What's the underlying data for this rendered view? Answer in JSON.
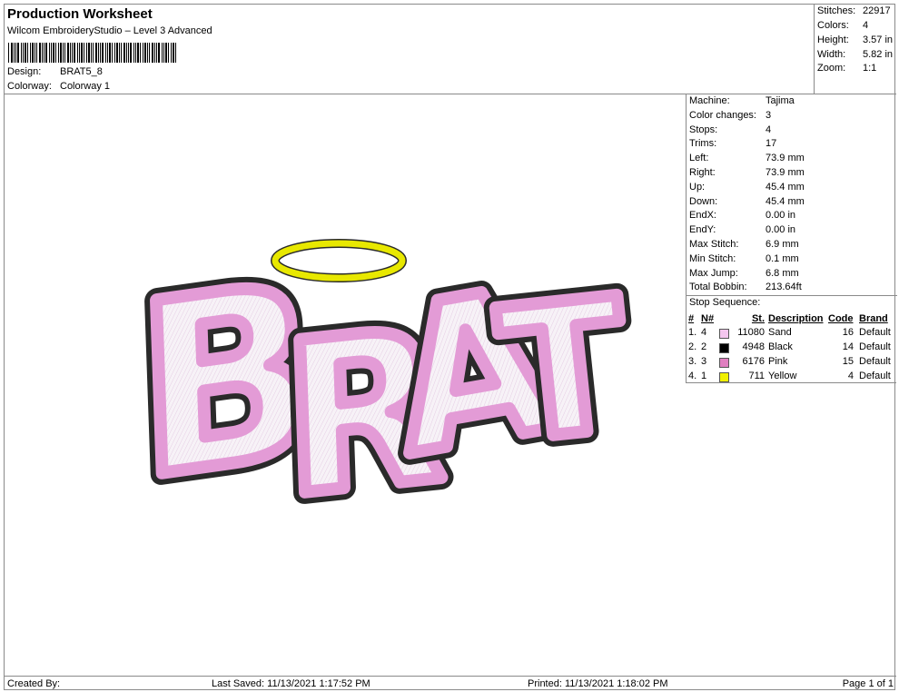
{
  "header": {
    "title": "Production Worksheet",
    "software": "Wilcom EmbroideryStudio – Level 3 Advanced",
    "design_label": "Design:",
    "design_value": "BRAT5_8",
    "colorway_label": "Colorway:",
    "colorway_value": "Colorway 1"
  },
  "stats": [
    {
      "label": "Stitches:",
      "value": "22917"
    },
    {
      "label": "Colors:",
      "value": "4"
    },
    {
      "label": "Height:",
      "value": "3.57 in"
    },
    {
      "label": "Width:",
      "value": "5.82 in"
    },
    {
      "label": "Zoom:",
      "value": "1:1"
    }
  ],
  "machine_info": [
    {
      "label": "Machine:",
      "value": "Tajima"
    },
    {
      "label": "Color changes:",
      "value": "3"
    },
    {
      "label": "Stops:",
      "value": "4"
    },
    {
      "label": "Trims:",
      "value": "17"
    },
    {
      "label": "Left:",
      "value": "73.9 mm"
    },
    {
      "label": "Right:",
      "value": "73.9 mm"
    },
    {
      "label": "Up:",
      "value": "45.4 mm"
    },
    {
      "label": "Down:",
      "value": "45.4 mm"
    },
    {
      "label": "EndX:",
      "value": "0.00 in"
    },
    {
      "label": "EndY:",
      "value": "0.00 in"
    },
    {
      "label": "Max Stitch:",
      "value": "6.9 mm"
    },
    {
      "label": "Min Stitch:",
      "value": "0.1 mm"
    },
    {
      "label": "Max Jump:",
      "value": "6.8 mm"
    },
    {
      "label": "Total Bobbin:",
      "value": "213.64ft"
    }
  ],
  "stop_sequence": {
    "title": "Stop Sequence:",
    "headers": [
      "#",
      "N#",
      "St.",
      "Description",
      "Code",
      "Brand"
    ],
    "rows": [
      {
        "num": "1.",
        "n": "4",
        "color": "#f4c6ee",
        "st": "11080",
        "desc": "Sand",
        "code": "16",
        "brand": "Default"
      },
      {
        "num": "2.",
        "n": "2",
        "color": "#000000",
        "st": "4948",
        "desc": "Black",
        "code": "14",
        "brand": "Default"
      },
      {
        "num": "3.",
        "n": "3",
        "color": "#e07fc0",
        "st": "6176",
        "desc": "Pink",
        "code": "15",
        "brand": "Default"
      },
      {
        "num": "4.",
        "n": "1",
        "color": "#f0f000",
        "st": "711",
        "desc": "Yellow",
        "code": "4",
        "brand": "Default"
      }
    ]
  },
  "design": {
    "text": [
      "B",
      "R",
      "A",
      "T"
    ],
    "colors": {
      "outline": "#2a2a2a",
      "pink": "#e39bd6",
      "fill": "#f3eef3",
      "halo": "#e8e800"
    }
  },
  "footer": {
    "created_by": "Created By:",
    "last_saved": "Last Saved: 11/13/2021 1:17:52 PM",
    "printed": "Printed: 11/13/2021 1:18:02 PM",
    "page": "Page 1 of 1"
  }
}
